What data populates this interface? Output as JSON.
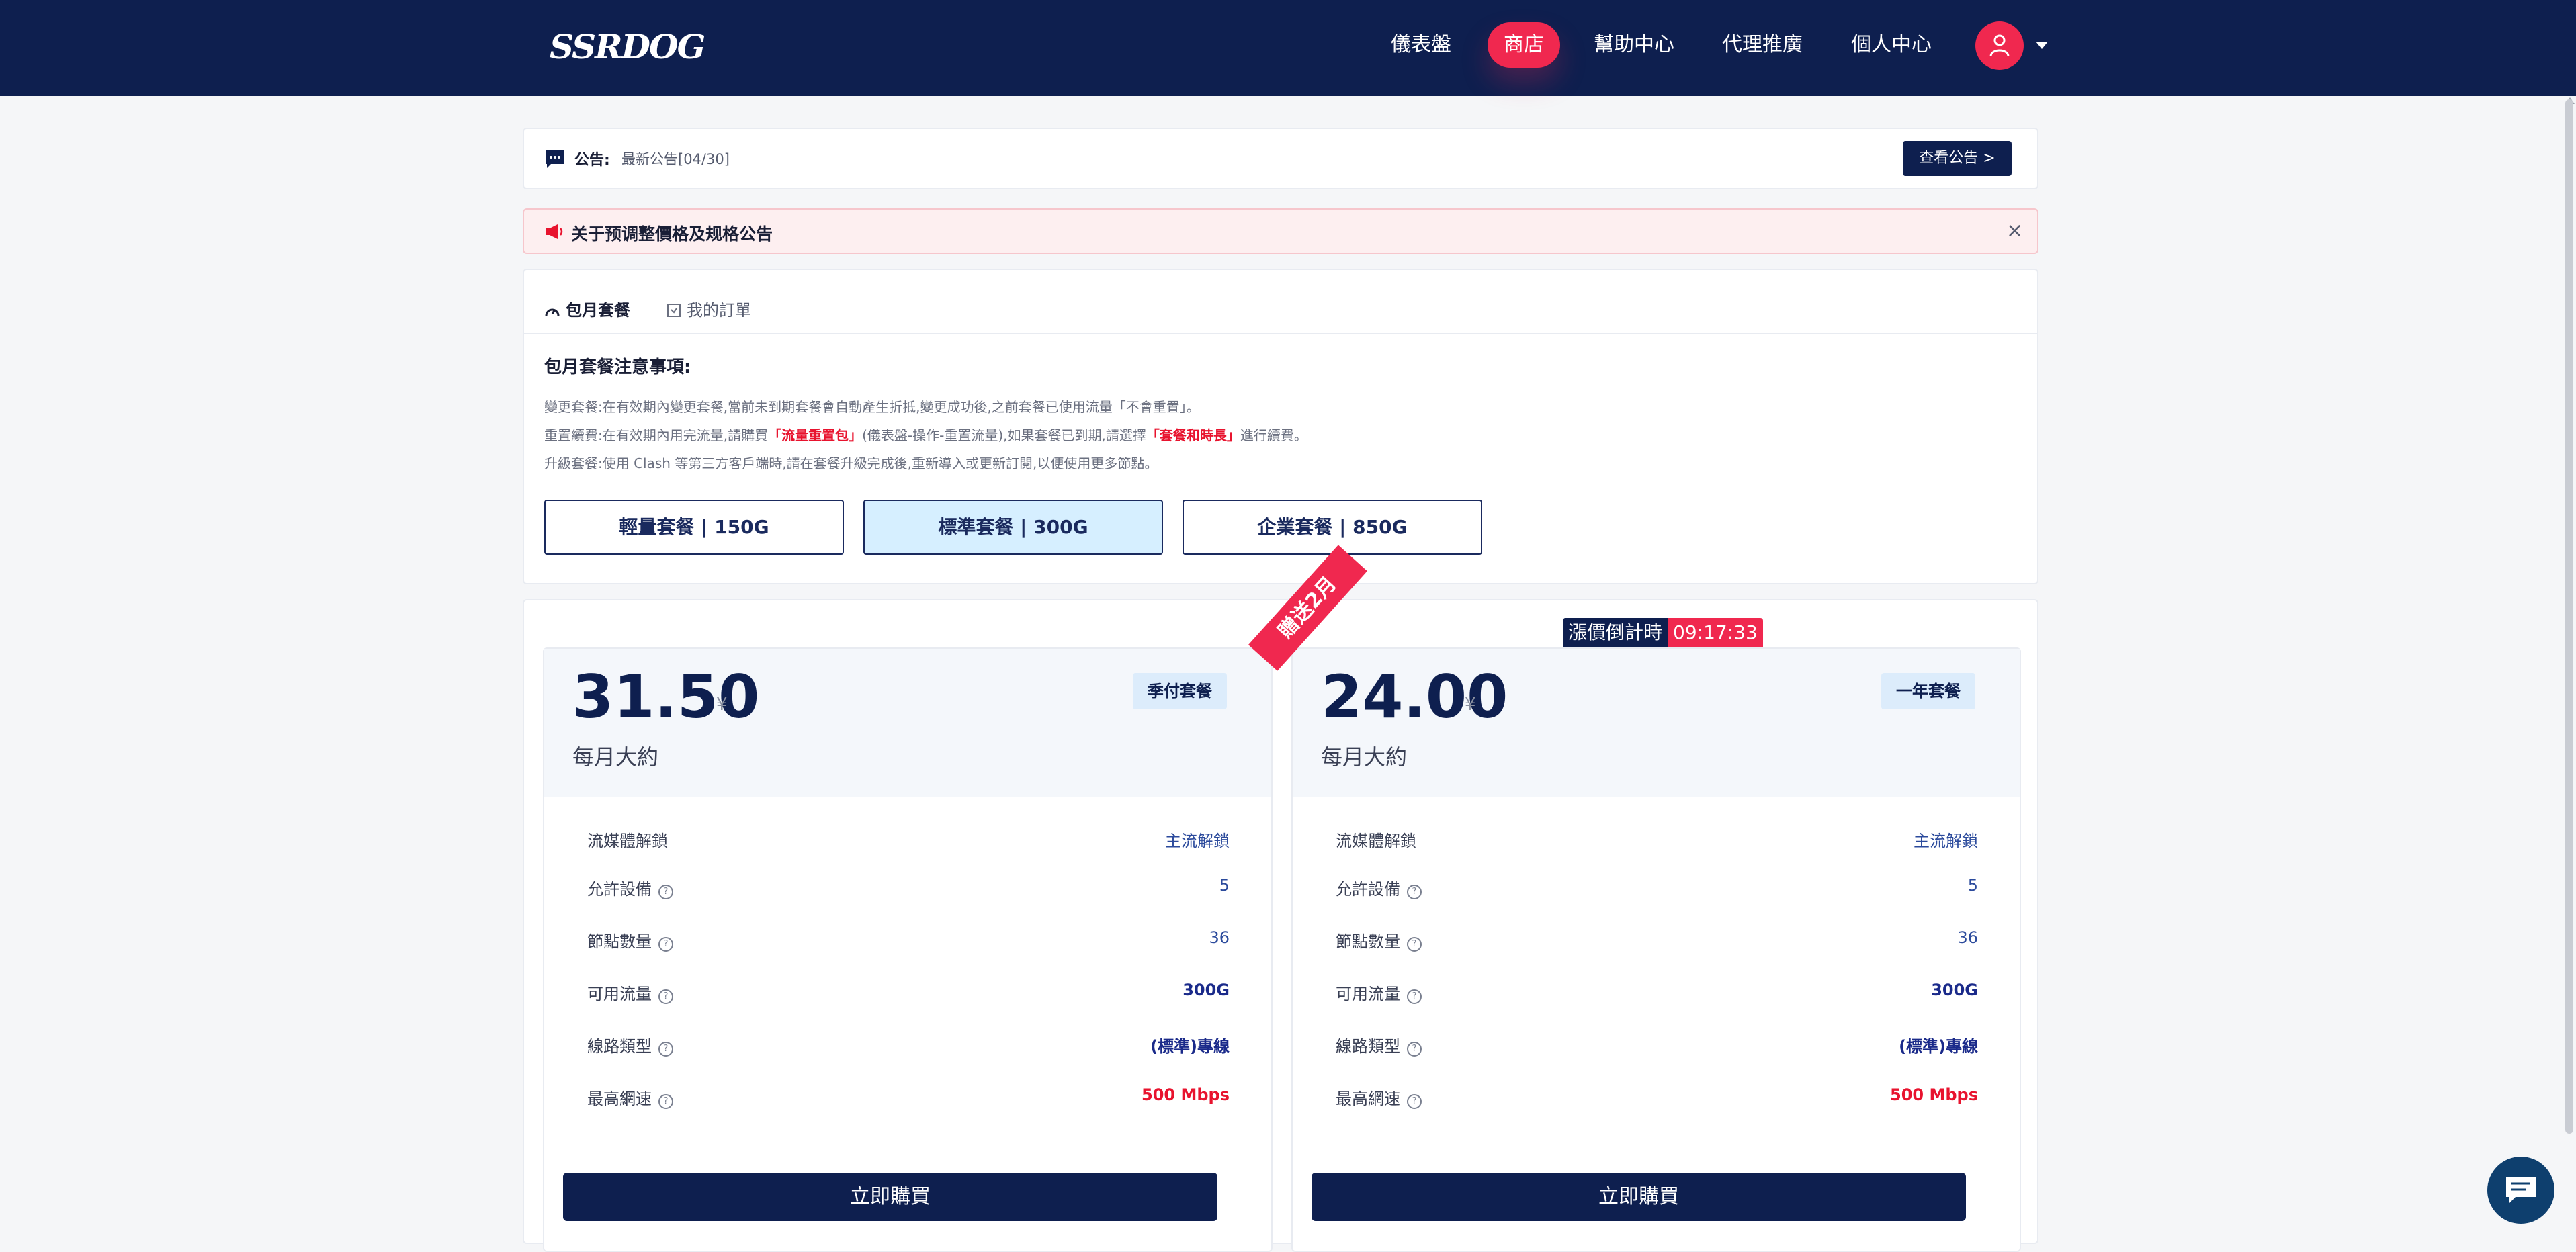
{
  "colors": {
    "nav_bg": "#0e1f4f",
    "accent": "#f0284f",
    "highlight_text": "#e8132e",
    "selected_package_bg": "#d6efff"
  },
  "header": {
    "logo_text": "SSRDOG",
    "nav": [
      {
        "label": "儀表盤",
        "active": false
      },
      {
        "label": "商店",
        "active": true
      },
      {
        "label": "幫助中心",
        "active": false
      },
      {
        "label": "代理推廣",
        "active": false
      },
      {
        "label": "個人中心",
        "active": false
      }
    ],
    "avatar_icon": "user-icon",
    "dropdown_icon": "caret-down-icon"
  },
  "notice": {
    "icon": "chat-bubble-icon",
    "label": "公告:",
    "text": "最新公告[04/30]",
    "button": "查看公告 >"
  },
  "alert": {
    "icon": "megaphone-icon",
    "title": "关于预调整價格及规格公告",
    "close": "×"
  },
  "tabs": [
    {
      "label": "包月套餐",
      "icon": "gauge-icon",
      "active": true
    },
    {
      "label": "我的訂單",
      "icon": "order-icon",
      "active": false
    }
  ],
  "notes": {
    "title": "包月套餐注意事項:",
    "line1": "變更套餐:在有效期內變更套餐,當前未到期套餐會自動產生折抵,變更成功後,之前套餐已使用流量「不會重置」。",
    "line2_a": "重置續費:在有效期內用完流量,請購買",
    "line2_hl1": "「流量重置包」",
    "line2_b": "(儀表盤-操作-重置流量),如果套餐已到期,請選擇",
    "line2_hl2": "「套餐和時長」",
    "line2_c": "進行續費。",
    "line3": "升級套餐:使用 Clash 等第三方客戶端時,請在套餐升級完成後,重新導入或更新訂閱,以便使用更多節點。"
  },
  "packages": [
    {
      "label": "輕量套餐 | 150G",
      "selected": false
    },
    {
      "label": "標準套餐 | 300G",
      "selected": true
    },
    {
      "label": "企業套餐 | 850G",
      "selected": false
    }
  ],
  "ribbon": "贈送2月",
  "countdown": {
    "label": "漲價倒計時",
    "time": "09:17:33"
  },
  "plans": [
    {
      "price": "31.50",
      "currency": "¥",
      "per": "每月大約",
      "badge": "季付套餐",
      "features": [
        {
          "name": "流媒體解鎖",
          "value": "主流解鎖"
        },
        {
          "name": "允許設備",
          "value": "5"
        },
        {
          "name": "節點數量",
          "value": "36"
        },
        {
          "name": "可用流量",
          "value": "300G"
        },
        {
          "name": "線路類型",
          "value": "(標準)專線"
        },
        {
          "name": "最高網速",
          "value": "500 Mbps"
        }
      ],
      "buy": "立即購買"
    },
    {
      "price": "24.00",
      "currency": "¥",
      "per": "每月大約",
      "badge": "一年套餐",
      "features": [
        {
          "name": "流媒體解鎖",
          "value": "主流解鎖"
        },
        {
          "name": "允許設備",
          "value": "5"
        },
        {
          "name": "節點數量",
          "value": "36"
        },
        {
          "name": "可用流量",
          "value": "300G"
        },
        {
          "name": "線路類型",
          "value": "(標準)專線"
        },
        {
          "name": "最高網速",
          "value": "500 Mbps"
        }
      ],
      "buy": "立即購買"
    }
  ],
  "help_icon": "question-circle-icon",
  "chat_widget_icon": "chat-widget-icon"
}
